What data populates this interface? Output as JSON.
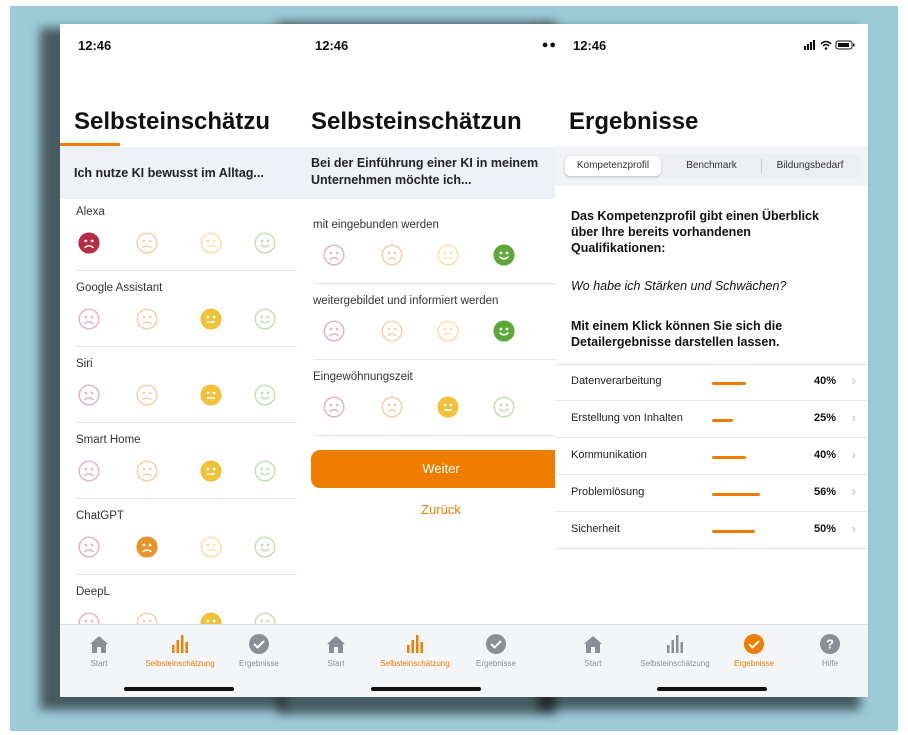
{
  "status_time": "12:46",
  "colors": {
    "accent": "#ef7d00",
    "frame": "#9ccad7",
    "very_bad": "#b52a45",
    "bad": "#e8922a",
    "neutral": "#f0c23a",
    "good": "#5ea83a"
  },
  "screen1": {
    "title": "Selbsteinschätzu",
    "question": "Ich nutze KI bewusst im Alltag...",
    "items": [
      {
        "label": "Alexa",
        "selected": 0
      },
      {
        "label": "Google Assistant",
        "selected": 2
      },
      {
        "label": "Siri",
        "selected": 2
      },
      {
        "label": "Smart Home",
        "selected": 2
      },
      {
        "label": "ChatGPT",
        "selected": 1
      },
      {
        "label": "DeepL",
        "selected": 2
      }
    ]
  },
  "screen2": {
    "title": "Selbsteinschätzun",
    "question_line1": "Bei der Einführung einer KI in meinem",
    "question_line2": "Unternehmen möchte ich...",
    "items": [
      {
        "label": "mit eingebunden werden",
        "selected": 3
      },
      {
        "label": "weitergebildet und informiert werden",
        "selected": 3
      },
      {
        "label": "Eingewöhnungszeit",
        "selected": 2
      }
    ],
    "next_label": "Weiter",
    "back_label": "Zurück"
  },
  "screen3": {
    "title": "Ergebnisse",
    "segments": [
      "Kompetenzprofil",
      "Benchmark",
      "Bildungsbedarf"
    ],
    "active_segment": 0,
    "intro_line1": "Das Kompetenzprofil gibt einen Überblick",
    "intro_line2": "über Ihre bereits vorhandenen",
    "intro_line3": "Qualifikationen:",
    "question": "Wo habe ich Stärken und Schwächen?",
    "hint_line1": "Mit einem Klick können Sie sich die",
    "hint_line2": "Detailergebnisse darstellen lassen.",
    "competences": [
      {
        "label": "Datenverarbeitung",
        "percent_label": "40%",
        "value": 40
      },
      {
        "label": "Erstellung von Inhalten",
        "percent_label": "25%",
        "value": 25
      },
      {
        "label": "Kommunikation",
        "percent_label": "40%",
        "value": 40
      },
      {
        "label": "Problemlösung",
        "percent_label": "56%",
        "value": 56
      },
      {
        "label": "Sicherheit",
        "percent_label": "50%",
        "value": 50
      }
    ]
  },
  "tabs": {
    "start": "Start",
    "self": "Selbsteinschätzung",
    "results": "Ergebnisse",
    "help": "Hilfe"
  },
  "icons": [
    "home-icon",
    "bar-chart-icon",
    "checkmark-circle-icon",
    "question-circle-icon",
    "signal-icon",
    "wifi-icon",
    "battery-icon",
    "chevron-right-icon"
  ]
}
